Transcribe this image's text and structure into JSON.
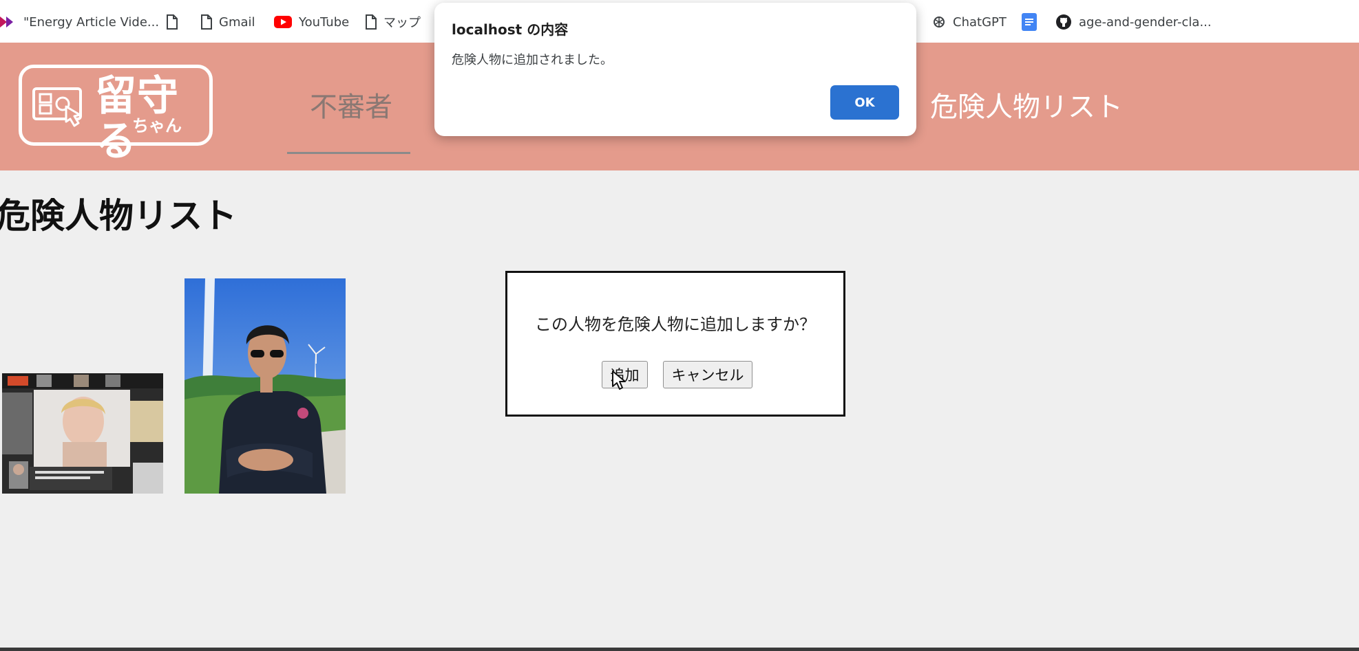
{
  "bookmarks": {
    "items": [
      {
        "label": "\"Energy Article Vide...",
        "icon": "arrow-bookmark-icon"
      },
      {
        "label": "",
        "icon": "document-icon"
      },
      {
        "label": "Gmail",
        "icon": "document-icon"
      },
      {
        "label": "YouTube",
        "icon": "youtube-icon"
      },
      {
        "label": "マップ",
        "icon": "document-icon"
      },
      {
        "label": "ChatGPT",
        "icon": "chatgpt-icon"
      },
      {
        "label": "",
        "icon": "docs-icon"
      },
      {
        "label": "age-and-gender-cla...",
        "icon": "github-icon"
      }
    ]
  },
  "header": {
    "logo_title": "留守る",
    "logo_sub": "ちゃん",
    "nav": [
      {
        "label": "不審者",
        "active": true
      },
      {
        "label": "危険人物リスト",
        "active": false
      }
    ],
    "colors": {
      "header_bg": "#e49b8c",
      "nav_underline": "#8a8a8a"
    }
  },
  "main": {
    "title": "危険人物リスト"
  },
  "modal": {
    "message": "この人物を危険人物に追加しますか？",
    "confirm_label": "追加",
    "cancel_label": "キャンセル"
  },
  "alert": {
    "title": "localhost の内容",
    "message": "危険人物に追加されました。",
    "ok_label": "OK",
    "colors": {
      "ok_bg": "#2b72d1"
    }
  }
}
